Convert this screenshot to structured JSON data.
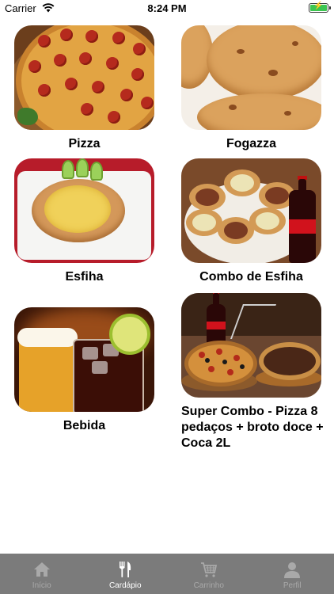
{
  "status_bar": {
    "carrier": "Carrier",
    "time": "8:24 PM"
  },
  "menu": {
    "items": [
      {
        "label": "Pizza"
      },
      {
        "label": "Fogazza"
      },
      {
        "label": "Esfiha"
      },
      {
        "label": "Combo de Esfiha"
      },
      {
        "label": "Bebida"
      },
      {
        "label": "Super Combo - Pizza 8 pedaços + broto doce + Coca 2L"
      }
    ]
  },
  "tab_bar": {
    "active": "Cardápio",
    "tabs": [
      {
        "label": "Início",
        "icon": "home-icon"
      },
      {
        "label": "Cardápio",
        "icon": "fork-knife-icon"
      },
      {
        "label": "Carrinho",
        "icon": "cart-icon"
      },
      {
        "label": "Perfil",
        "icon": "person-icon"
      }
    ]
  },
  "colors": {
    "tab_bar_bg": "#7b7b7b",
    "tab_inactive": "#a9a9a9",
    "tab_active": "#ffffff",
    "battery": "#3cc651"
  }
}
